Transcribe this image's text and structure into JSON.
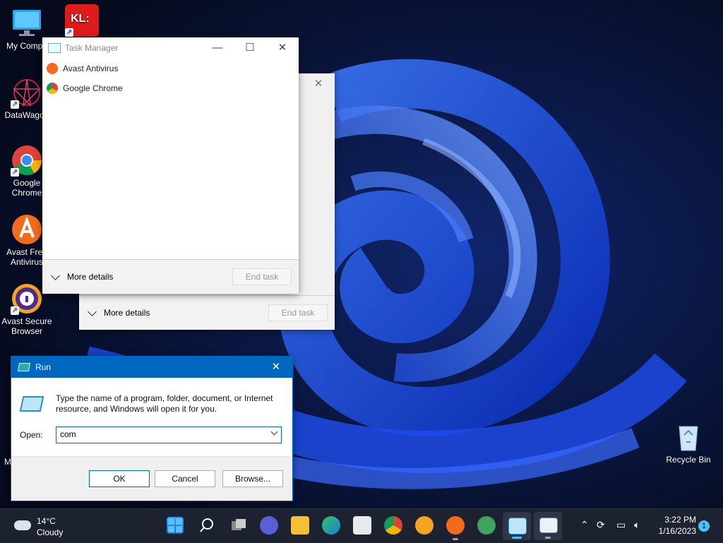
{
  "desktop": {
    "icons": [
      {
        "label": "My Compu",
        "icon": "computer-icon"
      },
      {
        "label": "DataWagon",
        "icon": "datawagon-icon"
      },
      {
        "label": "Google Chrome",
        "icon": "chrome-icon"
      },
      {
        "label": "Avast Free Antivirus",
        "icon": "avast-icon"
      },
      {
        "label": "Avast Secure Browser",
        "icon": "avast-browser-icon"
      },
      {
        "label": "Recycle Bin",
        "icon": "recycle-bin-icon"
      }
    ],
    "kl_label": "KL:",
    "partial_m": "M"
  },
  "task_manager": {
    "title": "Task Manager",
    "processes": [
      {
        "name": "Avast Antivirus",
        "icon": "avast-icon"
      },
      {
        "name": "Google Chrome",
        "icon": "chrome-icon"
      }
    ],
    "more_details": "More details",
    "end_task": "End task"
  },
  "task_manager_back": {
    "more_details": "More details",
    "end_task": "End task"
  },
  "run_dialog": {
    "title": "Run",
    "description": "Type the name of a program, folder, document, or Internet resource, and Windows will open it for you.",
    "open_label": "Open:",
    "input_value": "com",
    "ok": "OK",
    "cancel": "Cancel",
    "browse": "Browse..."
  },
  "taskbar": {
    "weather_temp": "14°C",
    "weather_cond": "Cloudy",
    "time": "3:22 PM",
    "date": "1/16/2023",
    "notification_count": "1",
    "pinned": [
      "start-icon",
      "search-icon",
      "task-view-icon",
      "chat-icon",
      "file-explorer-icon",
      "edge-icon",
      "store-icon",
      "chrome-icon",
      "avast-browser-icon",
      "avast-icon",
      "people-icon",
      "run-icon",
      "task-manager-icon"
    ]
  },
  "colors": {
    "accent": "#0067c0",
    "run_title_bg": "#0067c0"
  }
}
